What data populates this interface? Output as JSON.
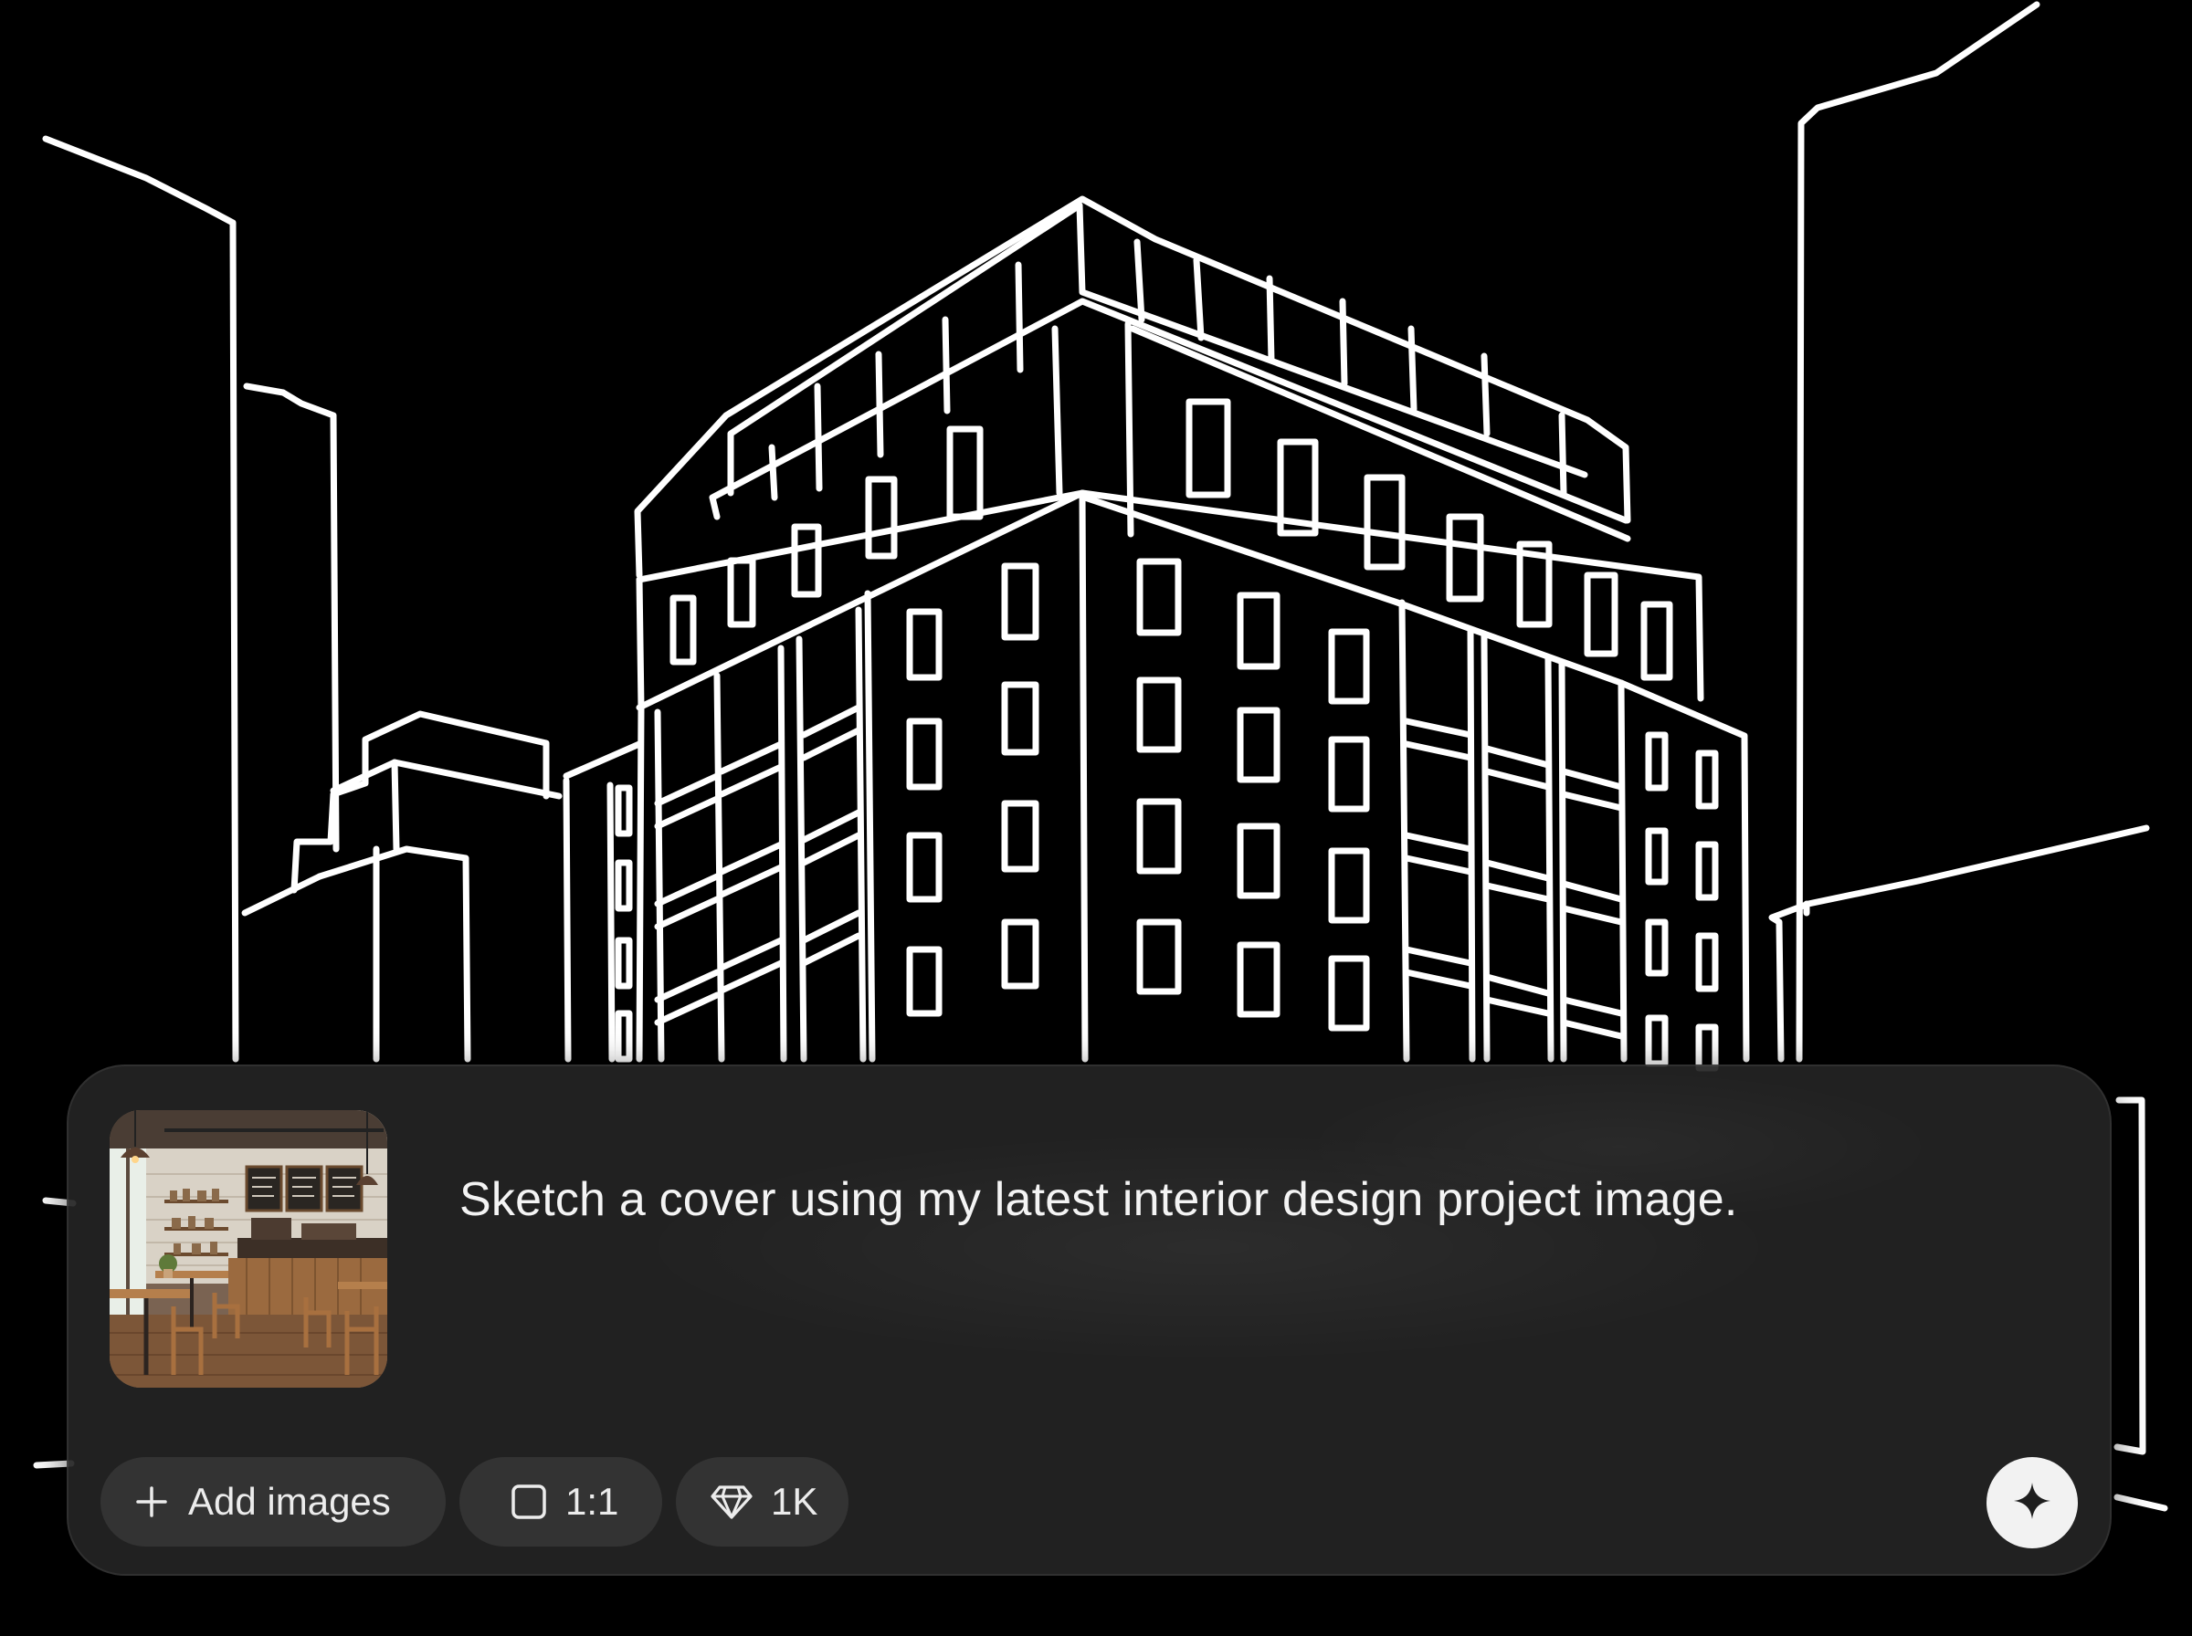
{
  "composer": {
    "prompt": "Sketch a cover using my latest interior design project image.",
    "attachment_thumbnail": "cafe-interior-photo",
    "chips": {
      "add_images": {
        "label": "Add images",
        "icon": "plus-icon"
      },
      "aspect_ratio": {
        "label": "1:1",
        "icon": "square-icon"
      },
      "quality": {
        "label": "1K",
        "icon": "diamond-icon"
      }
    },
    "send_icon": "sparkle-icon"
  },
  "colors": {
    "background": "#000000",
    "sketch_line": "#ffffff",
    "panel": "#242424",
    "chip": "#333333",
    "send_button": "#f2f2f2"
  }
}
